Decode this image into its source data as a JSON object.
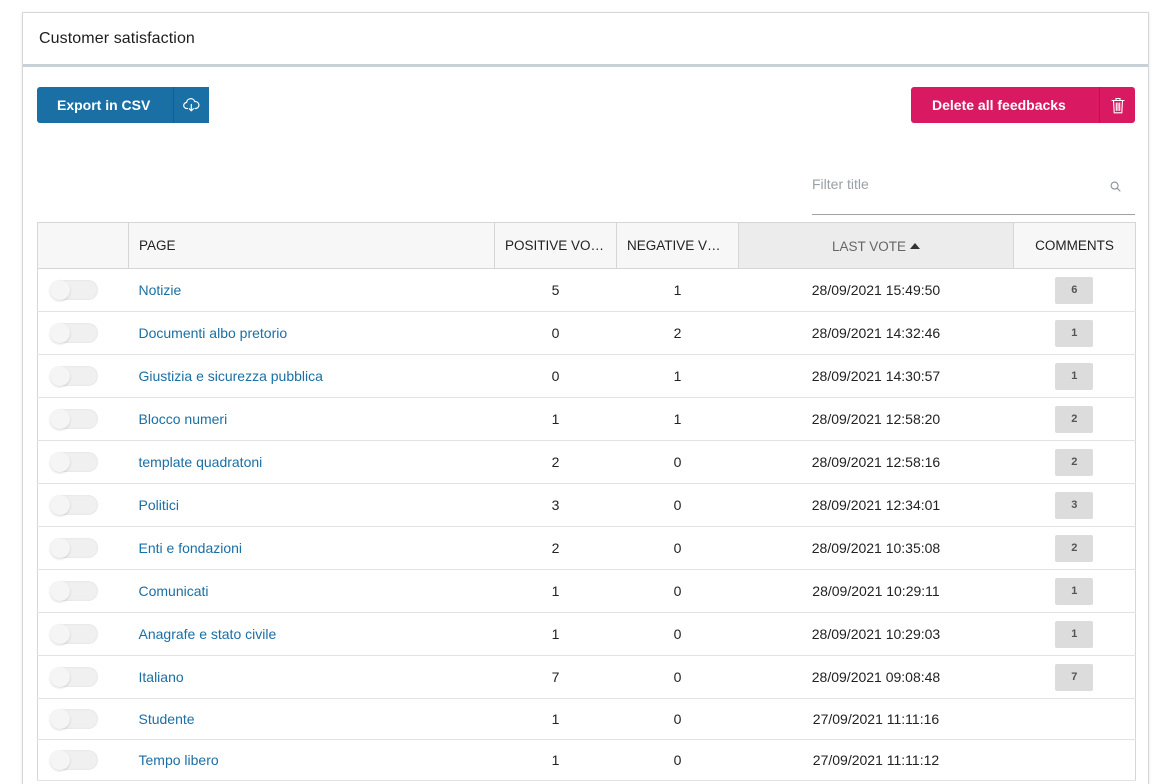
{
  "panel": {
    "title": "Customer satisfaction"
  },
  "toolbar": {
    "export_label": "Export in CSV",
    "export_icon": "cloud-download-icon",
    "delete_label": "Delete all feedbacks",
    "delete_icon": "trash-icon"
  },
  "filter": {
    "placeholder": "Filter title",
    "value": "",
    "icon": "search-icon"
  },
  "colors": {
    "primary": "#1a6fa5",
    "danger": "#d91a62",
    "header_bg": "#f7f7f7"
  },
  "table": {
    "headers": {
      "toggle": "",
      "page": "PAGE",
      "positive": "POSITIVE VOT...",
      "negative": "NEGATIVE VO...",
      "last_vote": "LAST VOTE",
      "comments": "COMMENTS"
    },
    "sorted_column": "last_vote",
    "rows": [
      {
        "page": "Notizie",
        "positive": "5",
        "negative": "1",
        "last_vote": "28/09/2021 15:49:50",
        "comments": "6"
      },
      {
        "page": "Documenti albo pretorio",
        "positive": "0",
        "negative": "2",
        "last_vote": "28/09/2021 14:32:46",
        "comments": "1"
      },
      {
        "page": "Giustizia e sicurezza pubblica",
        "positive": "0",
        "negative": "1",
        "last_vote": "28/09/2021 14:30:57",
        "comments": "1"
      },
      {
        "page": "Blocco numeri",
        "positive": "1",
        "negative": "1",
        "last_vote": "28/09/2021 12:58:20",
        "comments": "2"
      },
      {
        "page": "template quadratoni",
        "positive": "2",
        "negative": "0",
        "last_vote": "28/09/2021 12:58:16",
        "comments": "2"
      },
      {
        "page": "Politici",
        "positive": "3",
        "negative": "0",
        "last_vote": "28/09/2021 12:34:01",
        "comments": "3"
      },
      {
        "page": "Enti e fondazioni",
        "positive": "2",
        "negative": "0",
        "last_vote": "28/09/2021 10:35:08",
        "comments": "2"
      },
      {
        "page": "Comunicati",
        "positive": "1",
        "negative": "0",
        "last_vote": "28/09/2021 10:29:11",
        "comments": "1"
      },
      {
        "page": "Anagrafe e stato civile",
        "positive": "1",
        "negative": "0",
        "last_vote": "28/09/2021 10:29:03",
        "comments": "1"
      },
      {
        "page": "Italiano",
        "positive": "7",
        "negative": "0",
        "last_vote": "28/09/2021 09:08:48",
        "comments": "7"
      },
      {
        "page": "Studente",
        "positive": "1",
        "negative": "0",
        "last_vote": "27/09/2021 11:11:16",
        "comments": ""
      },
      {
        "page": "Tempo libero",
        "positive": "1",
        "negative": "0",
        "last_vote": "27/09/2021 11:11:12",
        "comments": ""
      }
    ]
  }
}
